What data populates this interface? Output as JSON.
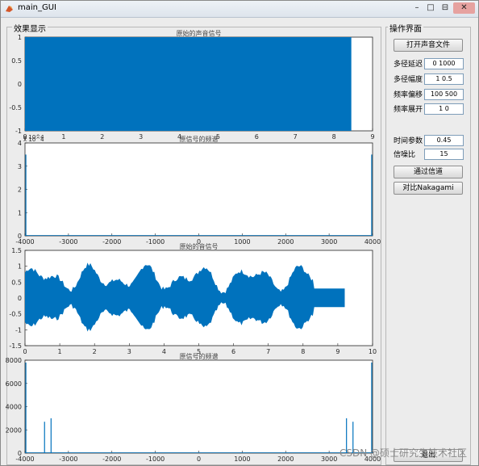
{
  "window": {
    "title": "main_GUI"
  },
  "left_panel": {
    "title": "效果显示"
  },
  "right_panel": {
    "title": "操作界面",
    "open_button": "打开声音文件",
    "params": [
      {
        "label": "多径延迟",
        "value": "0 1000"
      },
      {
        "label": "多径幅度",
        "value": "1 0.5"
      },
      {
        "label": "频率偏移",
        "value": "100 500"
      },
      {
        "label": "频率展开",
        "value": "1 0"
      }
    ],
    "time_param": {
      "label": "时间参数",
      "value": "0.45"
    },
    "snr": {
      "label": "信噪比",
      "value": "15"
    },
    "channel_button": "通过信道",
    "compare_button": "对比Nakagami",
    "exit_button": "退出"
  },
  "watermark": "CSDN @硕士研究生技术社区",
  "chart_data": [
    {
      "type": "line",
      "title": "原始的声音信号",
      "x_exponent": "x 10^4",
      "x_ticks": [
        "0",
        "1",
        "2",
        "3",
        "4",
        "5",
        "6",
        "7",
        "8",
        "9"
      ],
      "y_ticks": [
        "-1",
        "-0.5",
        "0",
        "0.5",
        "1"
      ],
      "xlim": [
        0,
        9
      ],
      "ylim": [
        -1,
        1
      ],
      "series": [
        {
          "color": "#0072bd",
          "x_end": 8.45,
          "amplitude": 1
        }
      ]
    },
    {
      "type": "line",
      "title": "原信号的频谱",
      "y_exponent": "x 10^4",
      "x_ticks": [
        "-4000",
        "-3000",
        "-2000",
        "-1000",
        "0",
        "1000",
        "2000",
        "3000",
        "4000"
      ],
      "y_ticks": [
        "0",
        "1",
        "2",
        "3",
        "4"
      ],
      "xlim": [
        -4000,
        4000
      ],
      "ylim": [
        0,
        4
      ],
      "peaks": [
        {
          "x": -3980,
          "y": 3.5
        },
        {
          "x": 3980,
          "y": 3.5
        }
      ]
    },
    {
      "type": "line",
      "title": "原始的音信号",
      "x_ticks": [
        "0",
        "1",
        "2",
        "3",
        "4",
        "5",
        "6",
        "7",
        "8",
        "9",
        "10"
      ],
      "y_ticks": [
        "-1.5",
        "-1",
        "-0.5",
        "0",
        "0.5",
        "1",
        "1.5"
      ],
      "xlim": [
        0,
        10
      ],
      "ylim": [
        -1.5,
        1.5
      ],
      "series": [
        {
          "color": "#0072bd",
          "x_end": 9.2
        }
      ]
    },
    {
      "type": "line",
      "title": "原信号的频谱",
      "x_ticks": [
        "-4000",
        "-3000",
        "-2000",
        "-1000",
        "0",
        "1000",
        "2000",
        "3000",
        "4000"
      ],
      "y_ticks": [
        "0",
        "2000",
        "4000",
        "6000",
        "8000"
      ],
      "xlim": [
        -4000,
        4000
      ],
      "ylim": [
        0,
        8000
      ],
      "peaks": [
        {
          "x": -3980,
          "y": 7800
        },
        {
          "x": -3550,
          "y": 2700
        },
        {
          "x": -3400,
          "y": 3000
        },
        {
          "x": 3400,
          "y": 3000
        },
        {
          "x": 3550,
          "y": 2700
        },
        {
          "x": 3980,
          "y": 7800
        }
      ]
    }
  ]
}
